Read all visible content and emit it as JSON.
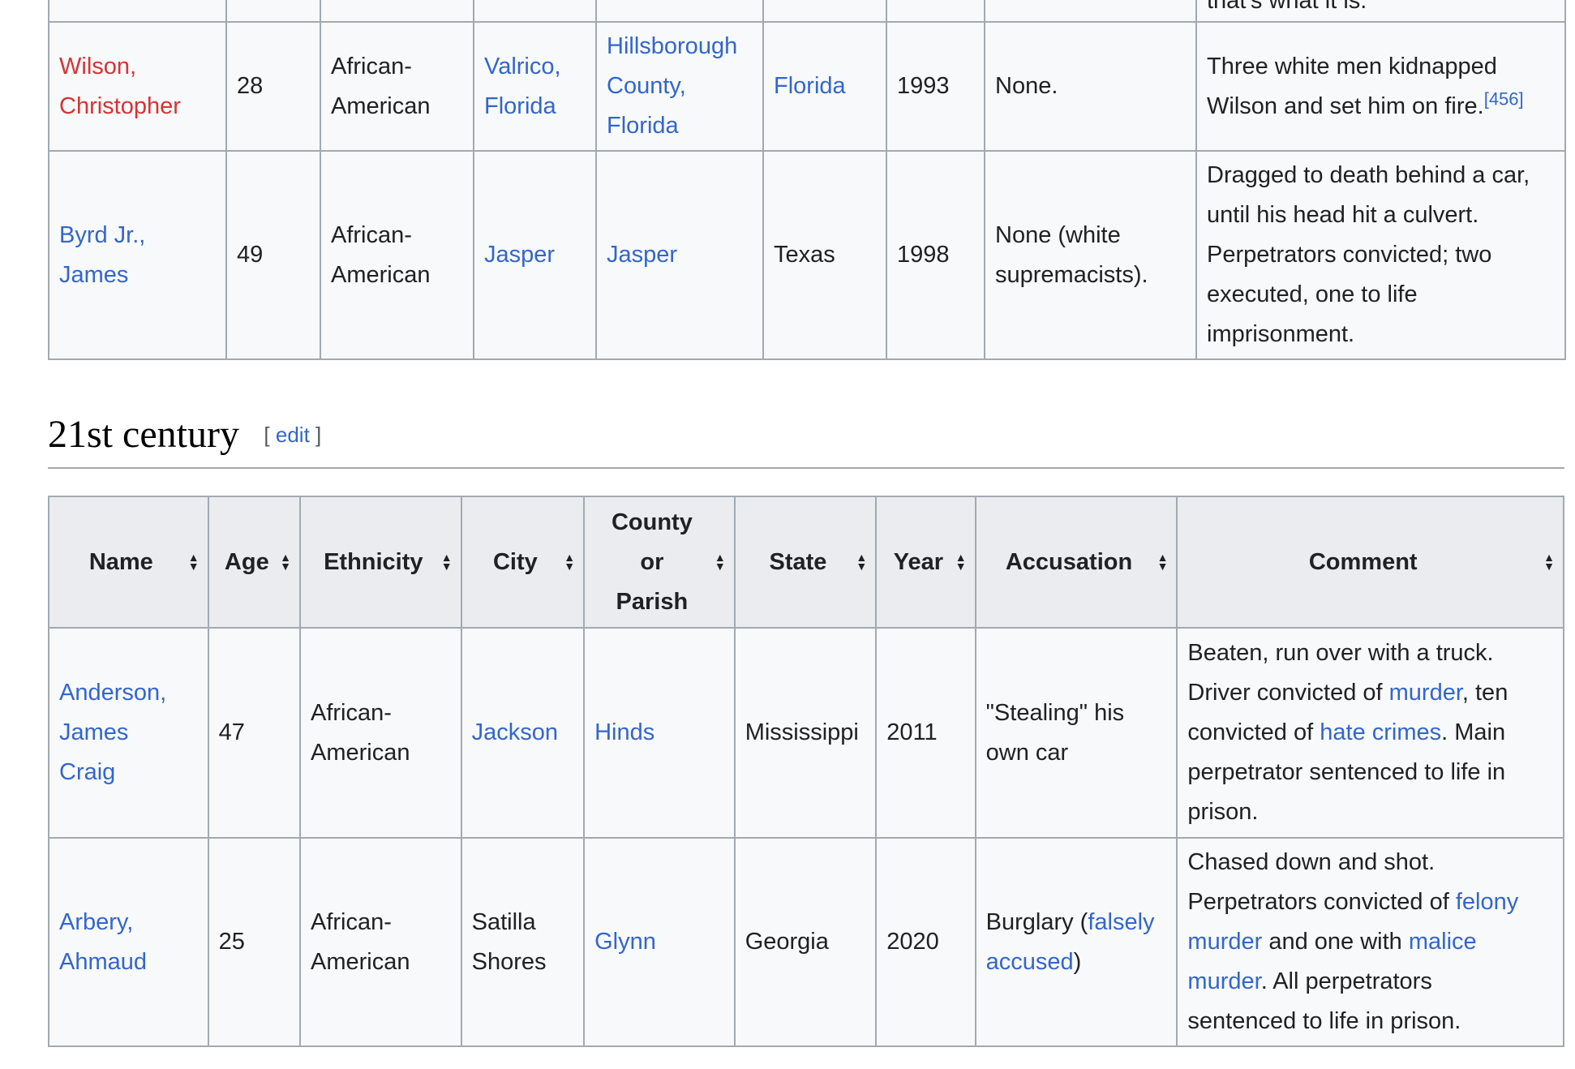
{
  "prev_table": {
    "cut_comment": "that's what it is.",
    "rows": [
      {
        "name_line1": "Wilson,",
        "name_line2": "Christopher",
        "age": "28",
        "ethnicity_line1": "African-",
        "ethnicity_line2": "American",
        "city_line1": "Valrico,",
        "city_line2": "Florida",
        "county_line1": "Hillsborough",
        "county_line2": "County,",
        "county_line3": "Florida",
        "state": "Florida",
        "year": "1993",
        "accusation": "None.",
        "comment_line1": "Three white men kidnapped",
        "comment_line2": "Wilson and set him on fire.",
        "comment_ref": "[456]"
      },
      {
        "name_line1": "Byrd Jr.,",
        "name_line2": "James",
        "age": "49",
        "ethnicity_line1": "African-",
        "ethnicity_line2": "American",
        "city": "Jasper",
        "county": "Jasper",
        "state": "Texas",
        "year": "1998",
        "accusation_line1": "None (white",
        "accusation_line2": "supremacists).",
        "comment_line1": "Dragged to death behind a car,",
        "comment_line2": "until his head hit a culvert.",
        "comment_line3": "Perpetrators convicted; two",
        "comment_line4": "executed, one to life",
        "comment_line5": "imprisonment."
      }
    ]
  },
  "section": {
    "title": "21st century",
    "edit_open": "[",
    "edit_label": "edit",
    "edit_close": "]"
  },
  "table": {
    "headers": {
      "name": "Name",
      "age": "Age",
      "ethnicity": "Ethnicity",
      "city": "City",
      "county_line1": "County",
      "county_line2": "or",
      "county_line3": "Parish",
      "state": "State",
      "year": "Year",
      "accusation": "Accusation",
      "comment": "Comment"
    },
    "rows": [
      {
        "name_line1": "Anderson,",
        "name_line2": "James",
        "name_line3": "Craig",
        "age": "47",
        "ethnicity_line1": "African-",
        "ethnicity_line2": "American",
        "city": "Jackson",
        "county": "Hinds",
        "state": "Mississippi",
        "year": "2011",
        "accusation_line1": "\"Stealing\" his",
        "accusation_line2": "own car",
        "c1": "Beaten, run over with a truck.",
        "c2a": "Driver convicted of ",
        "c2_link": "murder",
        "c2b": ", ten",
        "c3a": "convicted of ",
        "c3_link": "hate crimes",
        "c3b": ". Main",
        "c4": "perpetrator sentenced to life in",
        "c5": "prison."
      },
      {
        "name_line1": "Arbery,",
        "name_line2": "Ahmaud",
        "age": "25",
        "ethnicity_line1": "African-",
        "ethnicity_line2": "American",
        "city_line1": "Satilla",
        "city_line2": "Shores",
        "county": "Glynn",
        "state": "Georgia",
        "year": "2020",
        "acc1a": "Burglary (",
        "acc1_link": "falsely",
        "acc2_link": "accused",
        "acc2b": ")",
        "c1": "Chased down and shot.",
        "c2a": "Perpetrators convicted of ",
        "c2_link": "felony",
        "c3_link": "murder",
        "c3b": " and one with ",
        "c3_link2": "malice",
        "c4_link": "murder",
        "c4b": ". All perpetrators",
        "c5": "sentenced to life in prison."
      }
    ]
  }
}
